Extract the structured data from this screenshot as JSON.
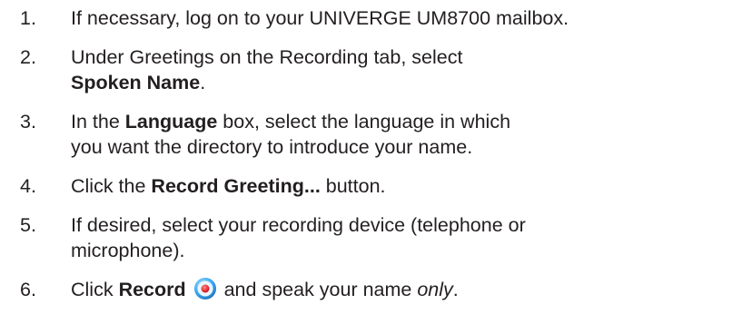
{
  "steps": [
    {
      "num": "1.",
      "lines": [
        {
          "text": "If necessary, log on to your UNIVERGE UM8700 mailbox."
        }
      ]
    },
    {
      "num": "2.",
      "line1": "Under Greetings on the Recording tab, select",
      "bold": "Spoken Name",
      "tail": "."
    },
    {
      "num": "3.",
      "pre": "In the ",
      "bold": "Language",
      "post": " box, select the language in which",
      "line2": "you want the directory to introduce your name."
    },
    {
      "num": "4.",
      "pre": "Click the ",
      "bold": "Record Greeting...",
      "post": " button."
    },
    {
      "num": "5.",
      "line1": "If desired, select your recording device (telephone or",
      "line2": "microphone)."
    },
    {
      "num": "6.",
      "pre": "Click ",
      "bold": "Record",
      "post": " and speak your name ",
      "italic": "only",
      "tail": "."
    }
  ],
  "icons": {
    "record": "record-button-icon",
    "record_ring_color": "#3fa9f5",
    "record_dot_color": "#e3262b"
  }
}
